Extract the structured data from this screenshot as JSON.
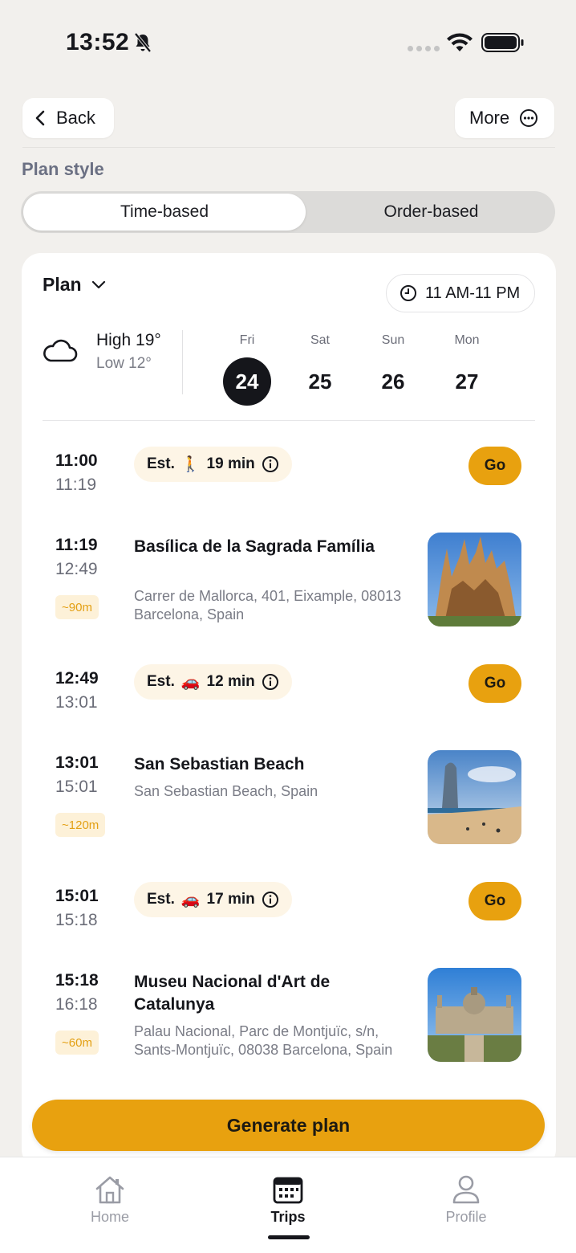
{
  "status_bar": {
    "time": "13:52"
  },
  "nav": {
    "back_label": "Back",
    "more_label": "More"
  },
  "plan_style": {
    "label": "Plan style",
    "options": [
      "Time-based",
      "Order-based"
    ],
    "selected": "Time-based"
  },
  "plan": {
    "dropdown_label": "Plan",
    "hours": "11 AM-11 PM",
    "weather": {
      "icon": "cloud-icon",
      "high": "High 19°",
      "low": "Low 12°"
    },
    "days": [
      {
        "name": "Fri",
        "num": "24",
        "selected": true
      },
      {
        "name": "Sat",
        "num": "25",
        "selected": false
      },
      {
        "name": "Sun",
        "num": "26",
        "selected": false
      },
      {
        "name": "Mon",
        "num": "27",
        "selected": false
      }
    ],
    "timeline": [
      {
        "type": "travel",
        "start": "11:00",
        "end": "11:19",
        "est_prefix": "Est.",
        "mode_icon": "walking-icon",
        "mode_glyph": "🚶",
        "duration": "19 min",
        "go_label": "Go"
      },
      {
        "type": "place",
        "start": "11:19",
        "end": "12:49",
        "badge": "~90m",
        "name": "Basílica de la Sagrada Família",
        "address": "Carrer de Mallorca, 401, Eixample, 08013 Barcelona, Spain"
      },
      {
        "type": "travel",
        "start": "12:49",
        "end": "13:01",
        "est_prefix": "Est.",
        "mode_icon": "car-icon",
        "mode_glyph": "🚗",
        "duration": "12 min",
        "go_label": "Go"
      },
      {
        "type": "place",
        "start": "13:01",
        "end": "15:01",
        "badge": "~120m",
        "name": "San Sebastian Beach",
        "address": "San Sebastian Beach, Spain"
      },
      {
        "type": "travel",
        "start": "15:01",
        "end": "15:18",
        "est_prefix": "Est.",
        "mode_icon": "car-icon",
        "mode_glyph": "🚗",
        "duration": "17 min",
        "go_label": "Go"
      },
      {
        "type": "place",
        "start": "15:18",
        "end": "16:18",
        "badge": "~60m",
        "name": "Museu Nacional d'Art de Catalunya",
        "address": "Palau Nacional, Parc de Montjuïc, s/n, Sants-Montjuïc, 08038 Barcelona, Spain"
      }
    ]
  },
  "generate_label": "Generate plan",
  "tabs": [
    {
      "label": "Home",
      "icon": "home-icon",
      "active": false
    },
    {
      "label": "Trips",
      "icon": "calendar-icon",
      "active": true
    },
    {
      "label": "Profile",
      "icon": "profile-icon",
      "active": false
    }
  ],
  "colors": {
    "accent": "#e8a10f",
    "background": "#f2f0ed",
    "badge_text": "#e3a015"
  }
}
